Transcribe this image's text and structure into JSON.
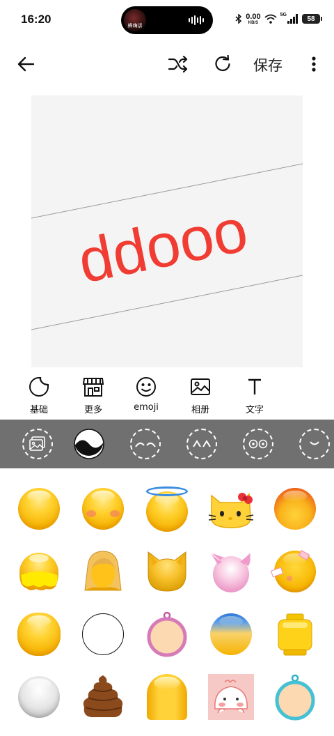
{
  "status_bar": {
    "time": "16:20",
    "island_label": "蜂嗨讲",
    "speed_value": "0.00",
    "speed_unit": "KB/S",
    "network": "5G",
    "battery": "58"
  },
  "toolbar": {
    "back_icon": "arrow-left-icon",
    "shuffle_icon": "shuffle-icon",
    "refresh_icon": "refresh-icon",
    "save_label": "保存",
    "more_icon": "more-vertical-icon"
  },
  "canvas": {
    "text": "ddooo",
    "text_color": "#f03c32",
    "background": "#f4f4f4"
  },
  "categories": [
    {
      "label": "基础",
      "icon": "sticker-icon"
    },
    {
      "label": "更多",
      "icon": "store-icon"
    },
    {
      "label": "emoji",
      "icon": "smiley-icon"
    },
    {
      "label": "相册",
      "icon": "image-icon"
    },
    {
      "label": "文字",
      "icon": "text-icon"
    }
  ],
  "sub_parts": [
    {
      "icon": "image-placeholder-icon",
      "selected": false
    },
    {
      "icon": "face-base-icon",
      "selected": true
    },
    {
      "icon": "eyebrows-icon",
      "selected": false
    },
    {
      "icon": "eyes-icon",
      "selected": false
    },
    {
      "icon": "round-eyes-icon",
      "selected": false
    },
    {
      "icon": "mouth-icon",
      "selected": false
    }
  ],
  "faces": [
    "plain-yellow-face",
    "blush-face",
    "halo-face",
    "kitty-face",
    "fire-face",
    "melting-face",
    "hair-face",
    "cat-face",
    "pink-devil-face",
    "bandaged-face",
    "round-yellow-face",
    "blank-white-face",
    "pink-ring-face",
    "blue-dye-face",
    "block-face",
    "silver-face",
    "poop-face",
    "bald-face",
    "pink-drawing-face",
    "teal-ring-face"
  ]
}
